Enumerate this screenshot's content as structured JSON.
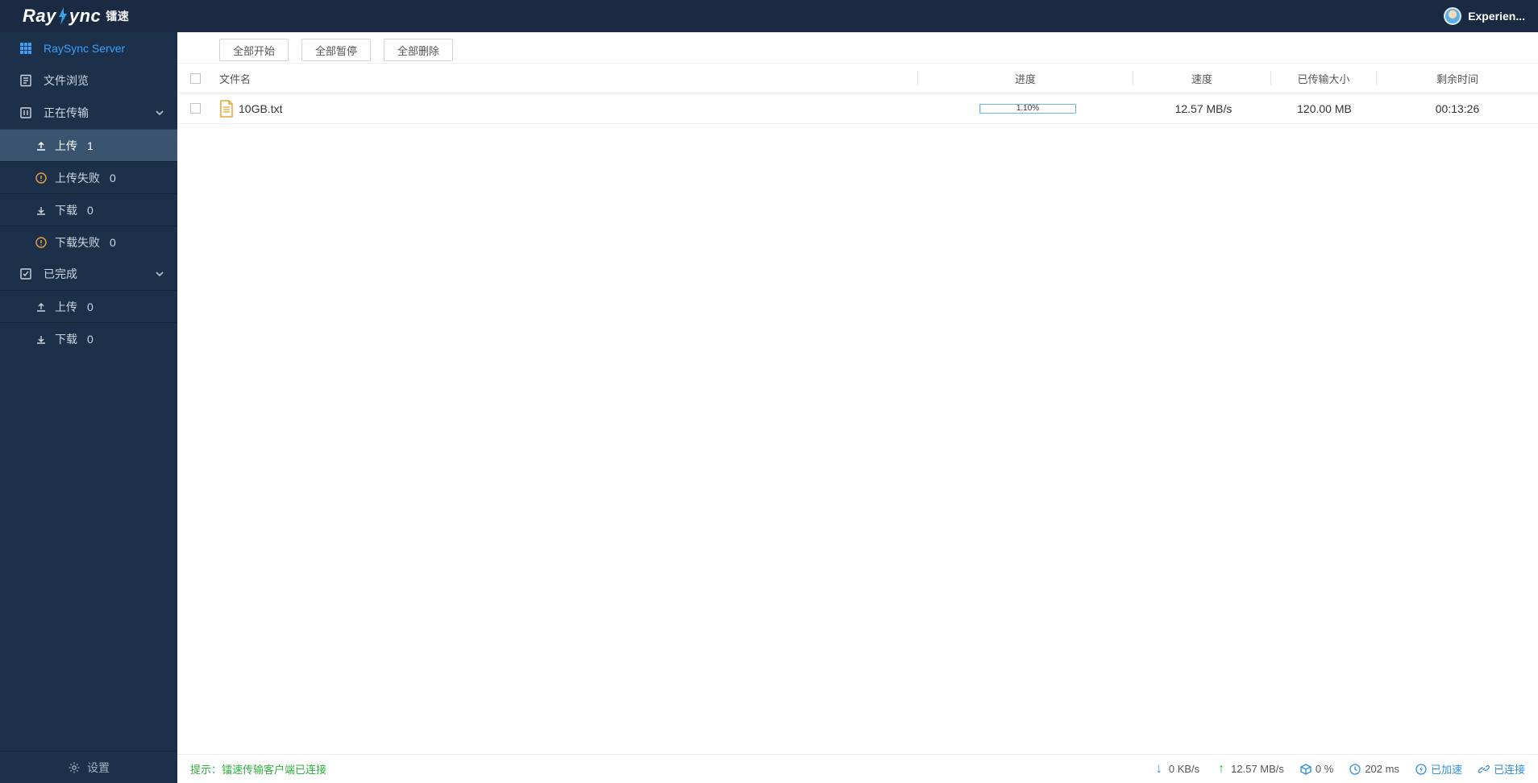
{
  "header": {
    "logo_main": "Ray",
    "logo_tail": "ync",
    "logo_cn": "镭速",
    "user_name": "Experien..."
  },
  "sidebar": {
    "server_label": "RaySync Server",
    "file_browse": "文件浏览",
    "transferring": "正在传输",
    "upload": "上传",
    "upload_count": "1",
    "upload_fail": "上传失败",
    "upload_fail_count": "0",
    "download": "下载",
    "download_count": "0",
    "download_fail": "下载失败",
    "download_fail_count": "0",
    "completed": "已完成",
    "completed_upload": "上传",
    "completed_upload_count": "0",
    "completed_download": "下载",
    "completed_download_count": "0",
    "settings": "设置"
  },
  "toolbar": {
    "start_all": "全部开始",
    "pause_all": "全部暂停",
    "delete_all": "全部删除"
  },
  "columns": {
    "name": "文件名",
    "progress": "进度",
    "speed": "速度",
    "transferred": "已传输大小",
    "remaining": "剩余时间"
  },
  "rows": [
    {
      "name": "10GB.txt",
      "progress_text": "1.10%",
      "progress_pct": 1.1,
      "speed": "12.57 MB/s",
      "transferred": "120.00 MB",
      "remaining": "00:13:26"
    }
  ],
  "status": {
    "hint_label": "提示：",
    "hint_text": "镭速传输客户端已连接",
    "down_speed": "0 KB/s",
    "up_speed": "12.57 MB/s",
    "packet_loss": "0 %",
    "latency": "202 ms",
    "accel": "已加速",
    "connected": "已连接"
  }
}
